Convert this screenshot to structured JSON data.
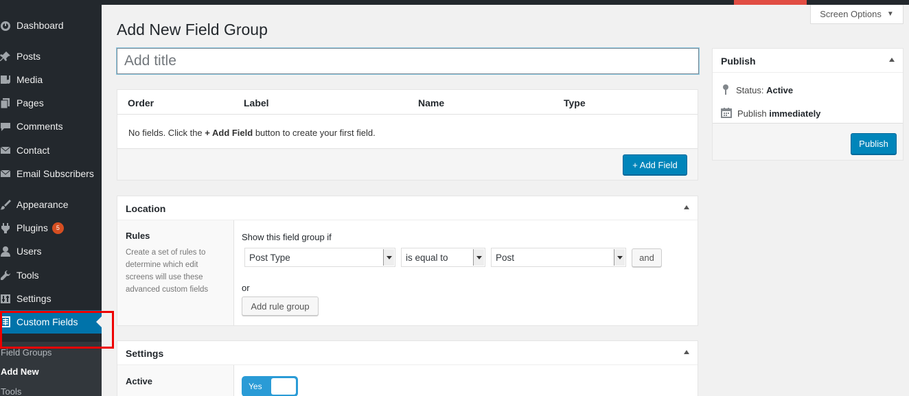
{
  "sidebar": {
    "items": [
      {
        "label": "Dashboard",
        "icon": "dashboard-icon"
      },
      {
        "label": "Posts",
        "icon": "pin-icon"
      },
      {
        "label": "Media",
        "icon": "media-icon"
      },
      {
        "label": "Pages",
        "icon": "pages-icon"
      },
      {
        "label": "Comments",
        "icon": "comment-icon"
      },
      {
        "label": "Contact",
        "icon": "mail-icon"
      },
      {
        "label": "Email Subscribers",
        "icon": "mail-icon"
      },
      {
        "label": "Appearance",
        "icon": "brush-icon"
      },
      {
        "label": "Plugins",
        "icon": "plugin-icon",
        "badge": "5"
      },
      {
        "label": "Users",
        "icon": "user-icon"
      },
      {
        "label": "Tools",
        "icon": "wrench-icon"
      },
      {
        "label": "Settings",
        "icon": "settings-icon"
      },
      {
        "label": "Custom Fields",
        "icon": "table-icon"
      }
    ],
    "submenu": [
      "Field Groups",
      "Add New",
      "Tools"
    ]
  },
  "header": {
    "screen_options": "Screen Options",
    "page_title": "Add New Field Group"
  },
  "title_input": {
    "placeholder": "Add title",
    "value": ""
  },
  "fields": {
    "columns": [
      "Order",
      "Label",
      "Name",
      "Type"
    ],
    "empty_prefix": "No fields. Click the ",
    "empty_link": "+ Add Field",
    "empty_suffix": " button to create your first field.",
    "add_button": "+ Add Field"
  },
  "location": {
    "title": "Location",
    "rules_title": "Rules",
    "rules_desc": "Create a set of rules to determine which edit screens will use these advanced custom fields",
    "show_if": "Show this field group if",
    "param": "Post Type",
    "operator": "is equal to",
    "value": "Post",
    "and_button": "and",
    "or_label": "or",
    "add_group_button": "Add rule group"
  },
  "settings": {
    "title": "Settings",
    "active_label": "Active",
    "toggle_label": "Yes"
  },
  "publish": {
    "title": "Publish",
    "status_label": "Status:",
    "status_value": "Active",
    "publish_label": "Publish",
    "publish_value": "immediately",
    "button": "Publish"
  },
  "colors": {
    "sidebar_bg": "#23282d",
    "accent": "#0073aa",
    "primary_button": "#0085ba",
    "highlight_box": "#ee0000"
  }
}
